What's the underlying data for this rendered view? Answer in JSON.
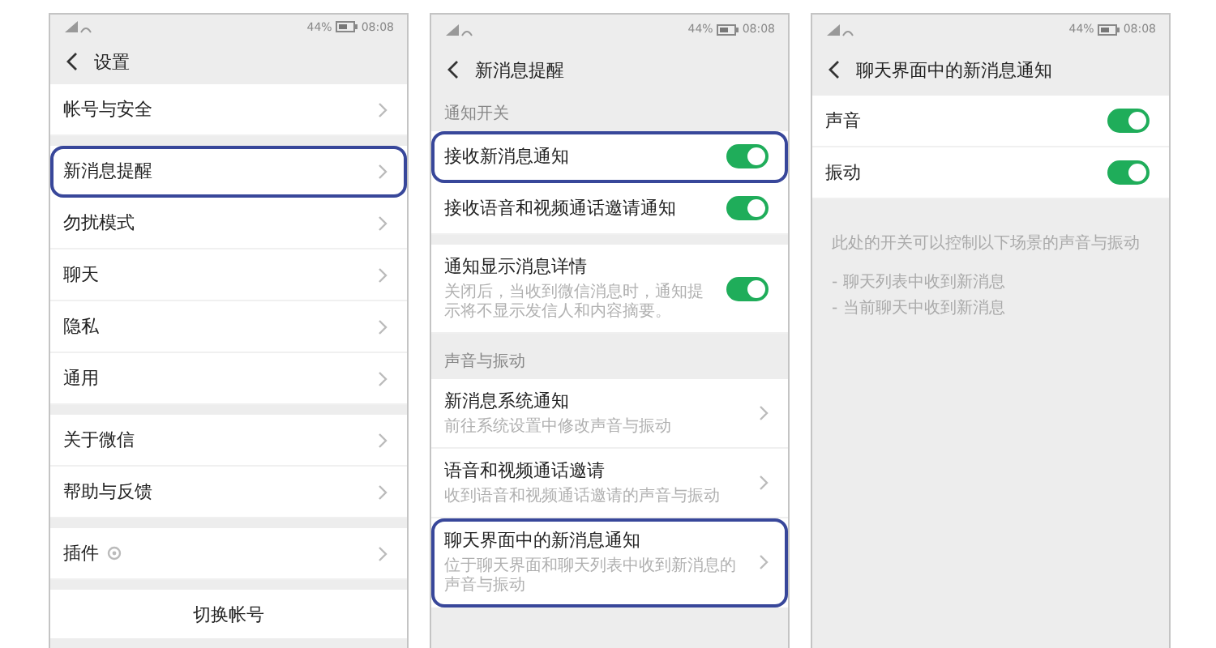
{
  "screens": [
    {
      "status_bar": {
        "battery": "44%",
        "time": "08:08"
      },
      "title": "设置",
      "sections": [
        {
          "items": [
            {
              "kind": "link",
              "label": "帐号与安全",
              "highlighted": false
            }
          ]
        },
        {
          "items": [
            {
              "kind": "link",
              "label": "新消息提醒",
              "highlighted": true
            },
            {
              "kind": "link",
              "label": "勿扰模式",
              "highlighted": false
            },
            {
              "kind": "link",
              "label": "聊天",
              "highlighted": false
            },
            {
              "kind": "link",
              "label": "隐私",
              "highlighted": false
            },
            {
              "kind": "link",
              "label": "通用",
              "highlighted": false
            }
          ]
        },
        {
          "items": [
            {
              "kind": "link",
              "label": "关于微信",
              "highlighted": false
            },
            {
              "kind": "link",
              "label": "帮助与反馈",
              "highlighted": false
            }
          ]
        },
        {
          "items": [
            {
              "kind": "link",
              "label": "插件",
              "highlighted": false,
              "badge_icon": true
            }
          ]
        },
        {
          "items": [
            {
              "kind": "button",
              "label": "切换帐号"
            }
          ]
        }
      ]
    },
    {
      "status_bar": {
        "battery": "44%",
        "time": "08:08"
      },
      "title": "新消息提醒",
      "sections": [
        {
          "header": "通知开关",
          "items": [
            {
              "kind": "toggle",
              "label": "接收新消息通知",
              "on": true,
              "highlighted": true
            },
            {
              "kind": "toggle",
              "label": "接收语音和视频通话邀请通知",
              "on": true,
              "highlighted": false
            }
          ]
        },
        {
          "items": [
            {
              "kind": "toggle",
              "label": "通知显示消息详情",
              "on": true,
              "highlighted": false,
              "description": "关闭后，当收到微信消息时，通知提示将不显示发信人和内容摘要。"
            }
          ]
        },
        {
          "header": "声音与振动",
          "items": [
            {
              "kind": "link",
              "label": "新消息系统通知",
              "highlighted": false,
              "description": "前往系统设置中修改声音与振动"
            },
            {
              "kind": "link",
              "label": "语音和视频通话邀请",
              "highlighted": false,
              "description": "收到语音和视频通话邀请的声音与振动"
            },
            {
              "kind": "link",
              "label": "聊天界面中的新消息通知",
              "highlighted": true,
              "description": "位于聊天界面和聊天列表中收到新消息的声音与振动"
            }
          ]
        }
      ]
    },
    {
      "status_bar": {
        "battery": "44%",
        "time": "08:08"
      },
      "title": "聊天界面中的新消息通知",
      "sections": [
        {
          "items": [
            {
              "kind": "toggle",
              "label": "声音",
              "on": true,
              "highlighted": false
            },
            {
              "kind": "toggle",
              "label": "振动",
              "on": true,
              "highlighted": false
            }
          ]
        }
      ],
      "note": {
        "text": "此处的开关可以控制以下场景的声音与振动",
        "lines": [
          "- 聊天列表中收到新消息",
          "- 当前聊天中收到新消息"
        ]
      }
    }
  ]
}
